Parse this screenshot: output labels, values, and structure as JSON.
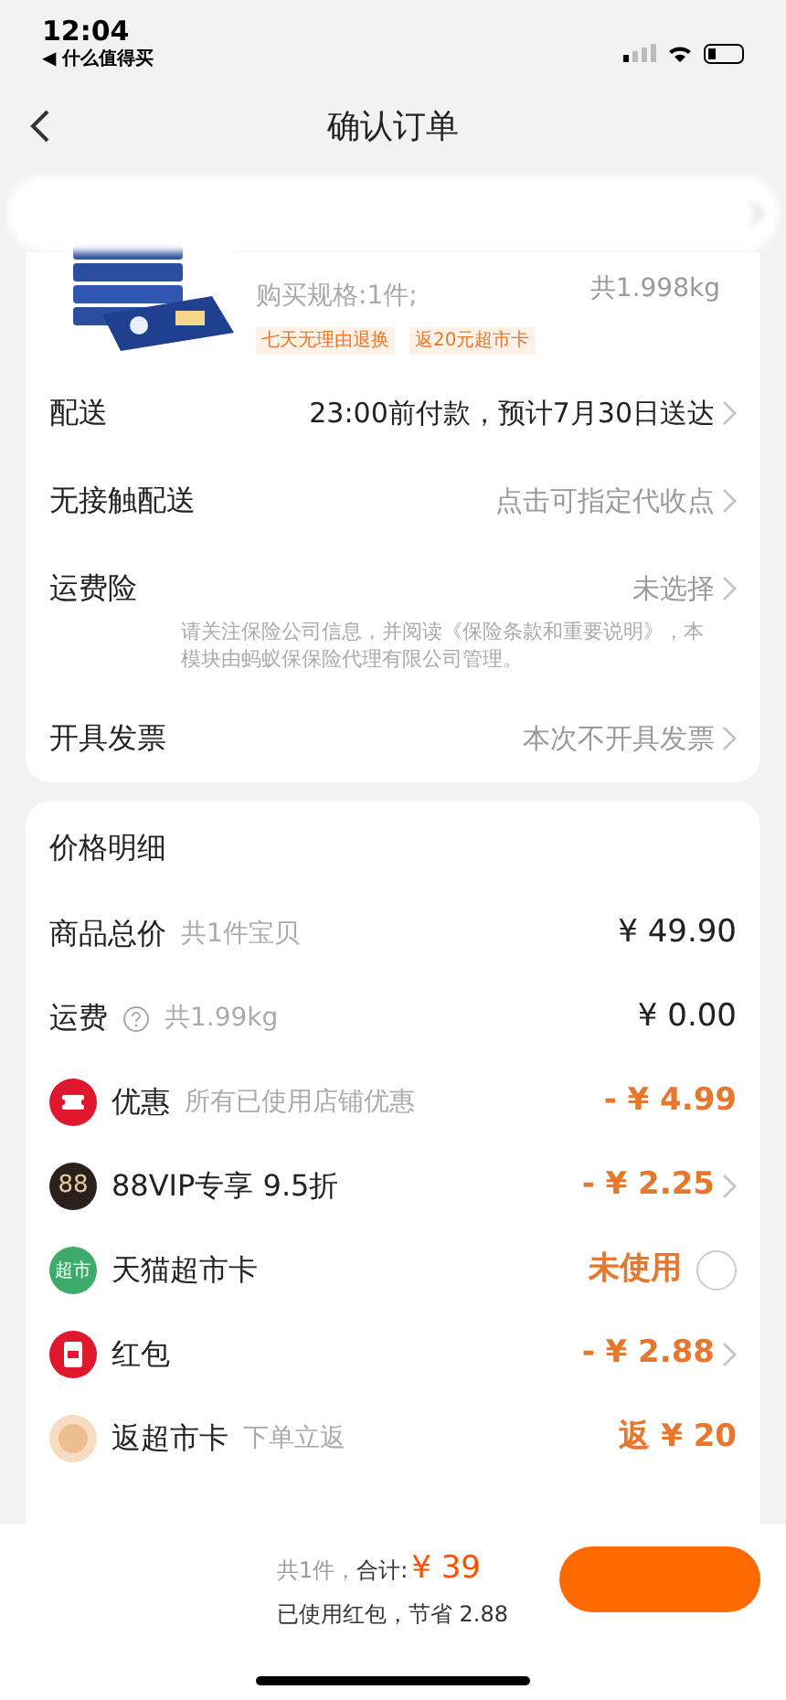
{
  "status_bar": {
    "time": "12:04",
    "back_app": "◀ 什么值得买"
  },
  "nav": {
    "title": "确认订单"
  },
  "product": {
    "spec": "购买规格:1件;",
    "weight": "共1.998kg",
    "tags": [
      "七天无理由退换",
      "返20元超市卡"
    ]
  },
  "options": [
    {
      "label": "配送",
      "value": "23:00前付款，预计7月30日送达",
      "emphasis": true
    },
    {
      "label": "无接触配送",
      "value": "点击可指定代收点",
      "emphasis": false
    },
    {
      "label": "运费险",
      "value": "未选择",
      "emphasis": false,
      "note": "请关注保险公司信息，并阅读《保险条款和重要说明》，本模块由蚂蚁保保险代理有限公司管理。"
    },
    {
      "label": "开具发票",
      "value": "本次不开具发票",
      "emphasis": false
    }
  ],
  "price": {
    "title": "价格明细",
    "rows": [
      {
        "kind": "plain",
        "label": "商品总价",
        "sub": "共1件宝贝",
        "amount": "¥ 49.90",
        "discount": false,
        "chevron": false
      },
      {
        "kind": "help",
        "label": "运费",
        "sub": "共1.99kg",
        "amount": "¥ 0.00",
        "discount": false,
        "chevron": false
      },
      {
        "kind": "ticket",
        "label": "优惠",
        "sub": "所有已使用店铺优惠",
        "amount": "- ¥ 4.99",
        "discount": true,
        "chevron": false
      },
      {
        "kind": "vip",
        "badge": "88",
        "label": "88VIP专享 9.5折",
        "amount": "- ¥ 2.25",
        "discount": true,
        "chevron": true
      },
      {
        "kind": "market",
        "badge": "超市",
        "label": "天猫超市卡",
        "amount": "未使用",
        "discount": true,
        "chevron": false,
        "checked": false
      },
      {
        "kind": "redpacket",
        "label": "红包",
        "amount": "- ¥ 2.88",
        "discount": true,
        "chevron": true
      },
      {
        "kind": "return",
        "label": "返超市卡",
        "sub": "下单立返",
        "amount": "返 ¥ 20",
        "discount": true,
        "chevron": false
      }
    ]
  },
  "footer": {
    "count": "共1件，",
    "total_label": "合计:",
    "total": "¥ 39",
    "note": "已使用红包，节省 2.88"
  }
}
